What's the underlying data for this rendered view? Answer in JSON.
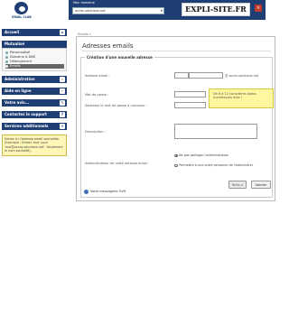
{
  "header": {
    "logo_text": "EMAIL CLUB",
    "topbar_label": "Mon domaine",
    "domain_value": "acces-solutions.net",
    "brand": "EXPLI-SITE.FR",
    "close_icon": "close-icon"
  },
  "sidebar": {
    "accueil": "Accueil",
    "mutualise": "Mutualisé",
    "mutualise_items": [
      "Personnalisé",
      "Domaine & DNS",
      "Hébergement",
      "Emails"
    ],
    "administration": "Administration",
    "aide": "Aide en ligne",
    "votre_avis": "Votre avis...",
    "contacter": "Contactez le support",
    "services": "Services additionnels",
    "hint": "Entrez ici l'adresse email souhaitée. (Exemple : Entrez 'moi' pour 'moi@acces-solutions.net'. Seulement le nom souhaité)."
  },
  "main": {
    "breadcrumb": "Emails »",
    "title": "Adresses emails",
    "legend": "Création d'une nouvelle adresse",
    "fields": {
      "email_label": "Adresse email :",
      "email_suffix": "@ acces-solutions.net",
      "password_label": "Mot de passe :",
      "password_confirm_label": "Saisissez le mot de passe à nouveau :",
      "tip": "De 6 à 12 caractères alpha-numériques max !",
      "description_label": "Description :",
      "admin_label": "Administrateur de cette adresse email :",
      "radio_1": "Ne pas partager l'administration",
      "radio_2": "Permettre à une autre personne de l'administrer"
    },
    "buttons": {
      "cancel": "Retour",
      "submit": "Valider"
    },
    "mail_link": "Votre messagerie OVH"
  }
}
